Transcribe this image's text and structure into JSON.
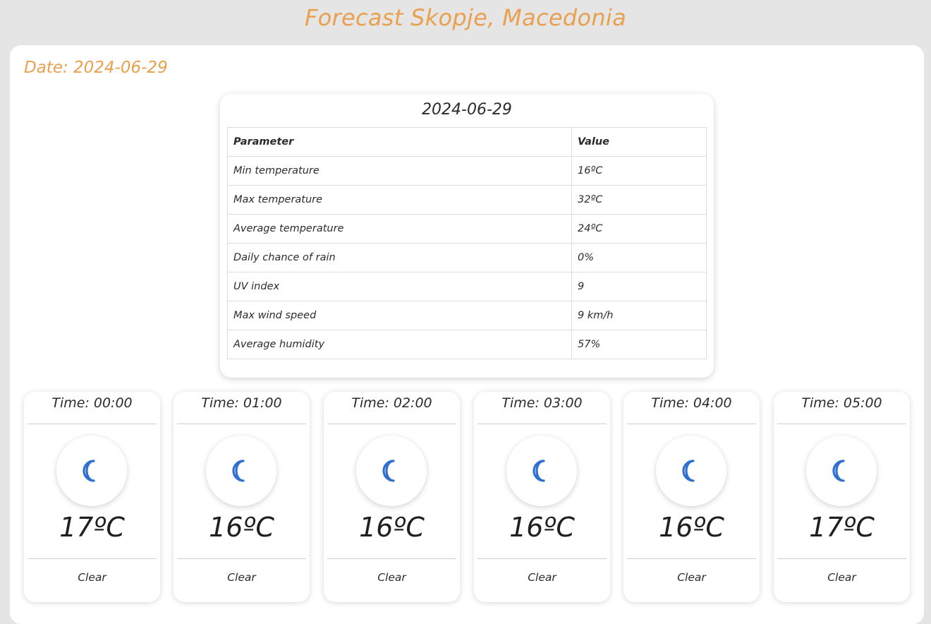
{
  "header": {
    "title": "Forecast Skopje, Macedonia"
  },
  "forecast": {
    "date_label": "Date: 2024-06-29"
  },
  "summary": {
    "title": "2024-06-29",
    "columns": [
      "Parameter",
      "Value"
    ],
    "rows": [
      {
        "parameter": "Min temperature",
        "value": "16ºC"
      },
      {
        "parameter": "Max temperature",
        "value": "32ºC"
      },
      {
        "parameter": "Average temperature",
        "value": "24ºC"
      },
      {
        "parameter": "Daily chance of rain",
        "value": "0%"
      },
      {
        "parameter": "UV index",
        "value": "9"
      },
      {
        "parameter": "Max wind speed",
        "value": "9 km/h"
      },
      {
        "parameter": "Average humidity",
        "value": "57%"
      }
    ]
  },
  "hourly": [
    {
      "time": "Time: 00:00",
      "temp": "17ºC",
      "condition": "Clear",
      "icon": "moon-icon"
    },
    {
      "time": "Time: 01:00",
      "temp": "16ºC",
      "condition": "Clear",
      "icon": "moon-icon"
    },
    {
      "time": "Time: 02:00",
      "temp": "16ºC",
      "condition": "Clear",
      "icon": "moon-icon"
    },
    {
      "time": "Time: 03:00",
      "temp": "16ºC",
      "condition": "Clear",
      "icon": "moon-icon"
    },
    {
      "time": "Time: 04:00",
      "temp": "16ºC",
      "condition": "Clear",
      "icon": "moon-icon"
    },
    {
      "time": "Time: 05:00",
      "temp": "17ºC",
      "condition": "Clear",
      "icon": "moon-icon"
    }
  ],
  "colors": {
    "accent": "#e9a04f",
    "moon": "#2f6fd0",
    "background": "#e5e5e5"
  }
}
